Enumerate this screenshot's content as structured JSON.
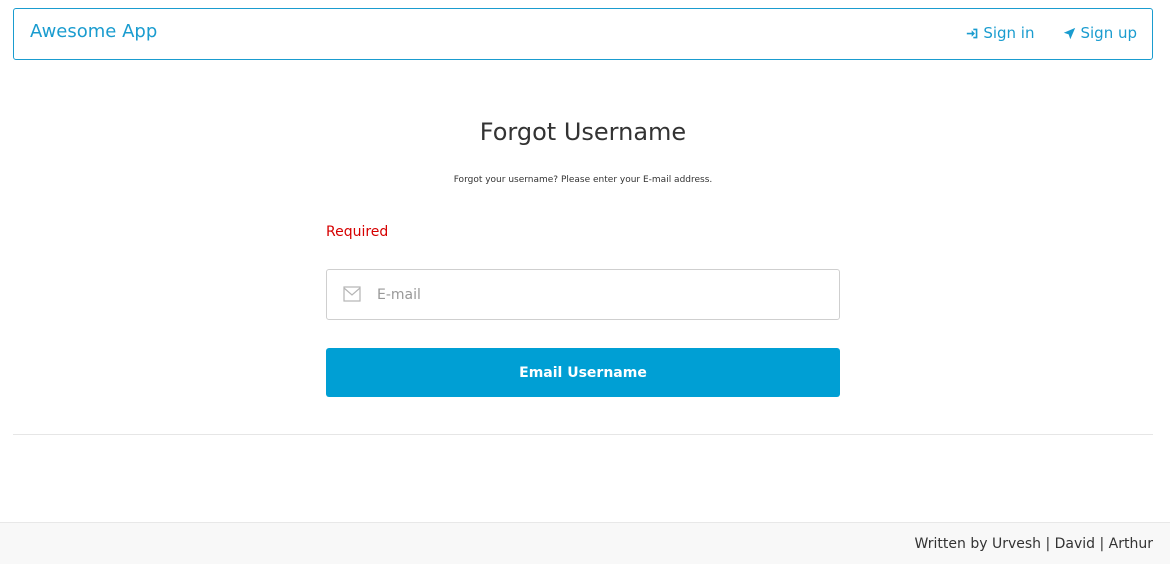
{
  "nav": {
    "brand": "Awesome App",
    "sign_in": {
      "label": "Sign in",
      "icon": "sign-in-icon"
    },
    "sign_up": {
      "label": "Sign up",
      "icon": "rocket-icon"
    }
  },
  "main": {
    "title": "Forgot Username",
    "subtitle": "Forgot your username? Please enter your E-mail address.",
    "required_label": "Required",
    "email_field": {
      "placeholder": "E-mail",
      "value": "",
      "icon": "envelope-icon"
    },
    "submit_label": "Email Username"
  },
  "footer": {
    "text": "Written by Urvesh | David | Arthur"
  },
  "colors": {
    "accent": "#1a9ccf",
    "button": "#009fd4",
    "error": "#d60000"
  }
}
